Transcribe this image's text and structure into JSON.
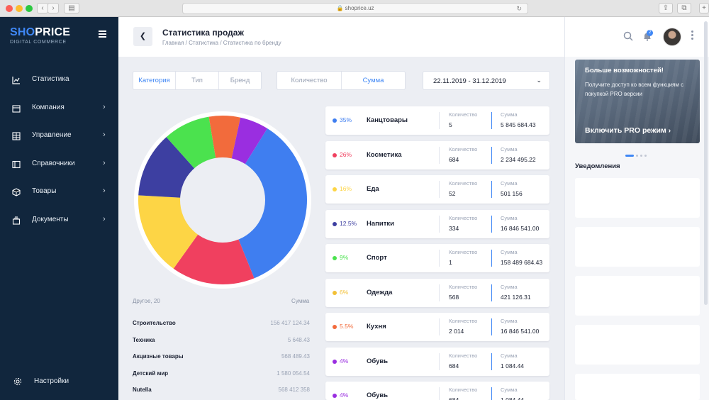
{
  "browser": {
    "url": "shoprice.uz"
  },
  "sidebar": {
    "logo": {
      "part1": "SHO",
      "part2": "PRICE",
      "subtitle": "DIGITAL COMMERCE"
    },
    "items": [
      {
        "label": "Статистика",
        "icon": "chart-line-icon",
        "chevron": false
      },
      {
        "label": "Компания",
        "icon": "store-icon",
        "chevron": true
      },
      {
        "label": "Управление",
        "icon": "grid-icon",
        "chevron": true
      },
      {
        "label": "Справочники",
        "icon": "book-icon",
        "chevron": true
      },
      {
        "label": "Товары",
        "icon": "box-icon",
        "chevron": true
      },
      {
        "label": "Документы",
        "icon": "documents-icon",
        "chevron": true
      }
    ],
    "settings_label": "Настройки"
  },
  "header": {
    "title": "Статистика продаж",
    "breadcrumb": "Главная  /  Статистика  /  Статистика по бренду"
  },
  "filters": {
    "group_tabs": [
      "Категория",
      "Тип",
      "Бренд"
    ],
    "group_active": 0,
    "metric_tabs": [
      "Количество",
      "Сумма"
    ],
    "metric_active": 1,
    "date_range": "22.11.2019 - 31.12.2019"
  },
  "colors": {
    "accent": "#3f87f5",
    "sidebar_bg": "#11263d",
    "slices": [
      "#3f7ef0",
      "#f0405f",
      "#fdd545",
      "#3d3fa1",
      "#4be24e",
      "#f26b3c",
      "#9a2ee0"
    ]
  },
  "chart_data": {
    "type": "pie",
    "values": [
      35,
      16,
      16,
      12.5,
      9,
      6,
      5.5
    ]
  },
  "categories": [
    {
      "pct": "35%",
      "name": "Канцтовары",
      "qty": "5",
      "sum": "5 845 684.43",
      "color": "#3f7ef0"
    },
    {
      "pct": "26%",
      "name": "Косметика",
      "qty": "684",
      "sum": "2 234 495.22",
      "color": "#f0405f"
    },
    {
      "pct": "16%",
      "name": "Еда",
      "qty": "52",
      "sum": "501 156",
      "color": "#fdd545"
    },
    {
      "pct": "12.5%",
      "name": "Напитки",
      "qty": "334",
      "sum": "16 846 541.00",
      "color": "#3d3fa1"
    },
    {
      "pct": "9%",
      "name": "Спорт",
      "qty": "1",
      "sum": "158 489 684.43",
      "color": "#4be24e"
    },
    {
      "pct": "6%",
      "name": "Одежда",
      "qty": "568",
      "sum": "421 126.31",
      "color": "#f2c037"
    },
    {
      "pct": "5.5%",
      "name": "Кухня",
      "qty": "2 014",
      "sum": "16 846 541.00",
      "color": "#f26b3c"
    },
    {
      "pct": "4%",
      "name": "Обувь",
      "qty": "684",
      "sum": "1 084.44",
      "color": "#9a2ee0"
    },
    {
      "pct": "4%",
      "name": "Обувь",
      "qty": "684",
      "sum": "1 084.44",
      "color": "#9a2ee0"
    }
  ],
  "card_labels": {
    "qty": "Количество",
    "sum": "Сумма"
  },
  "other": {
    "title": "Другое, 20",
    "sum_label": "Сумма",
    "rows": [
      {
        "name": "Строительство",
        "value": "156 417 124.34"
      },
      {
        "name": "Техника",
        "value": "5 648.43"
      },
      {
        "name": "Акцизные товары",
        "value": "568 489.43"
      },
      {
        "name": "Детский мир",
        "value": "1 580 054.54"
      },
      {
        "name": "Nutella",
        "value": "568 412 358"
      }
    ]
  },
  "right_panel": {
    "notification_count": "2",
    "promo": {
      "title": "Больше возможностей!",
      "text": "Получите доступ ко всем функциям с покупкой PRO версии",
      "link": "Включить PRO режим"
    },
    "notifications_title": "Уведомления"
  }
}
